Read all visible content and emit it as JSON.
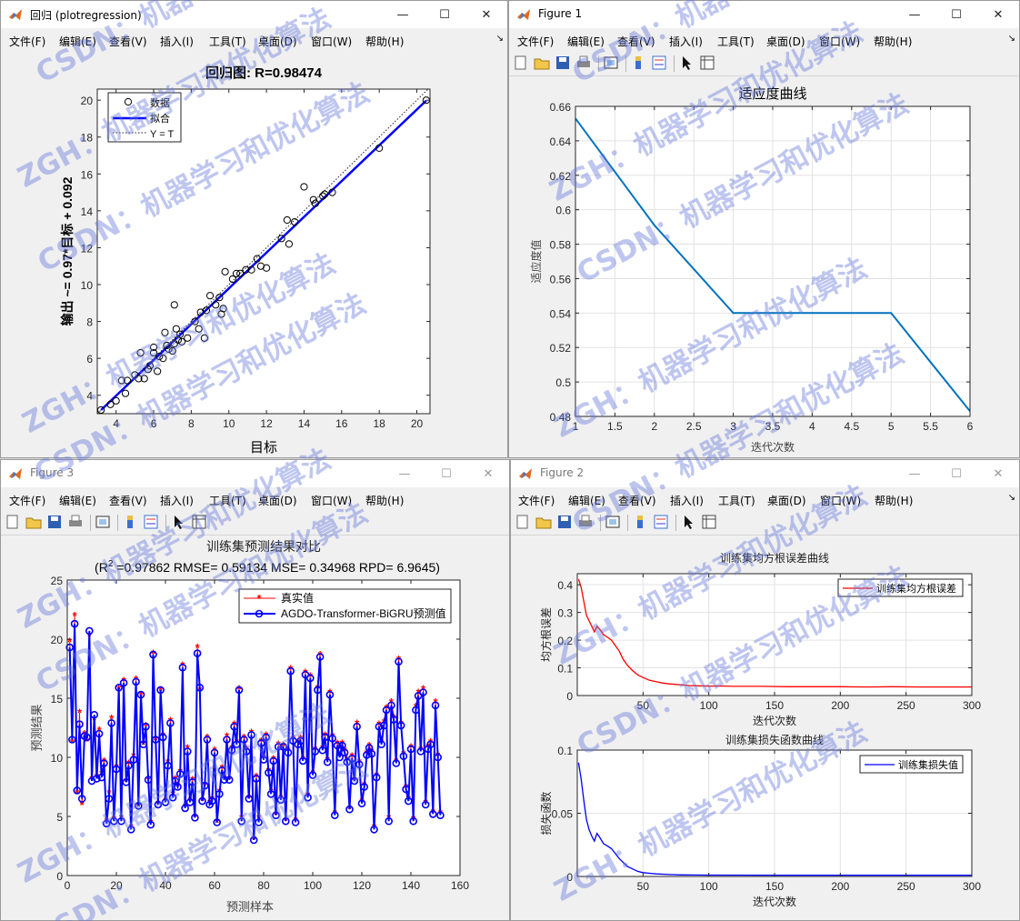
{
  "menu": {
    "file": "文件(F)",
    "edit": "编辑(E)",
    "view": "查看(V)",
    "insert": "插入(I)",
    "tools": "工具(T)",
    "desktop": "桌面(D)",
    "window": "窗口(W)",
    "help": "帮助(H)"
  },
  "windows": {
    "w1": {
      "title": "回归 (plotregression)"
    },
    "w2": {
      "title": "Figure 1"
    },
    "w3": {
      "title": "Figure 3"
    },
    "w4": {
      "title": "Figure 2"
    }
  },
  "watermark": {
    "line1": "CSDN：机器学习和优化算法",
    "line2": "ZGH：机器学习和优化算法"
  },
  "chart_data": [
    {
      "type": "scatter",
      "title": "回归图: R=0.98474",
      "xlabel": "目标",
      "ylabel": "输出 ~= 0.97*目标 + 0.092",
      "xlim": [
        3,
        20.7
      ],
      "ylim": [
        3,
        20.6
      ],
      "xticks": [
        4,
        6,
        8,
        10,
        12,
        14,
        16,
        18,
        20
      ],
      "yticks": [
        4,
        6,
        8,
        10,
        12,
        14,
        16,
        18,
        20
      ],
      "legend": [
        "数据",
        "拟合",
        "Y = T"
      ],
      "legend_position": "top-left",
      "fit": {
        "slope": 0.97,
        "intercept": 0.092
      },
      "points": [
        [
          3.2,
          3.2
        ],
        [
          3.7,
          3.5
        ],
        [
          4.0,
          3.7
        ],
        [
          4.3,
          4.8
        ],
        [
          4.5,
          4.1
        ],
        [
          4.6,
          4.8
        ],
        [
          5.0,
          5.1
        ],
        [
          5.2,
          4.9
        ],
        [
          5.3,
          6.3
        ],
        [
          5.5,
          4.9
        ],
        [
          5.7,
          5.4
        ],
        [
          5.8,
          5.6
        ],
        [
          6.0,
          6.3
        ],
        [
          6.0,
          6.6
        ],
        [
          6.2,
          5.3
        ],
        [
          6.3,
          6.1
        ],
        [
          6.5,
          6.0
        ],
        [
          6.6,
          7.4
        ],
        [
          6.8,
          6.5
        ],
        [
          7.0,
          6.4
        ],
        [
          7.1,
          6.8
        ],
        [
          7.2,
          7.6
        ],
        [
          7.3,
          7.0
        ],
        [
          7.4,
          7.3
        ],
        [
          7.5,
          6.9
        ],
        [
          7.8,
          7.1
        ],
        [
          8.2,
          8.0
        ],
        [
          8.4,
          7.6
        ],
        [
          8.5,
          8.5
        ],
        [
          8.8,
          8.6
        ],
        [
          9.0,
          9.4
        ],
        [
          9.3,
          8.9
        ],
        [
          9.5,
          9.3
        ],
        [
          9.6,
          8.4
        ],
        [
          9.7,
          8.7
        ],
        [
          9.8,
          10.7
        ],
        [
          10.2,
          10.3
        ],
        [
          10.4,
          10.6
        ],
        [
          10.6,
          10.6
        ],
        [
          10.9,
          10.8
        ],
        [
          11.2,
          10.8
        ],
        [
          11.5,
          11.4
        ],
        [
          11.7,
          11.0
        ],
        [
          12.0,
          10.9
        ],
        [
          12.8,
          12.5
        ],
        [
          13.1,
          13.5
        ],
        [
          13.2,
          12.2
        ],
        [
          13.5,
          13.4
        ],
        [
          14.0,
          15.3
        ],
        [
          14.5,
          14.6
        ],
        [
          14.6,
          14.4
        ],
        [
          15.0,
          14.8
        ],
        [
          15.1,
          14.9
        ],
        [
          15.5,
          15.0
        ],
        [
          18.0,
          17.4
        ],
        [
          20.5,
          20.0
        ],
        [
          7.1,
          8.9
        ],
        [
          6.7,
          6.7
        ],
        [
          8.7,
          7.1
        ]
      ]
    },
    {
      "type": "line",
      "title": "适应度曲线",
      "xlabel": "迭代次数",
      "ylabel": "适应度值",
      "xlim": [
        1,
        6
      ],
      "ylim": [
        0.48,
        0.66
      ],
      "xticks": [
        1,
        1.5,
        2,
        2.5,
        3,
        3.5,
        4,
        4.5,
        5,
        5.5,
        6
      ],
      "yticks": [
        0.48,
        0.5,
        0.52,
        0.54,
        0.56,
        0.58,
        0.6,
        0.62,
        0.64,
        0.66
      ],
      "xtick_labels": [
        "1",
        "1.5",
        "2",
        "2.5",
        "3",
        "3.5",
        "4",
        "4.5",
        "5",
        "5.5",
        "6"
      ],
      "ytick_labels": [
        "0.48",
        "0.5",
        "0.52",
        "0.54",
        "0.56",
        "0.58",
        "0.6",
        "0.62",
        "0.64",
        "0.66"
      ],
      "grid": true,
      "x": [
        1,
        2,
        3,
        4,
        5,
        6
      ],
      "y": [
        0.653,
        0.591,
        0.54,
        0.54,
        0.54,
        0.483
      ]
    },
    {
      "type": "line",
      "title": "训练集预测结果对比",
      "subtitle_pre": "(R",
      "subtitle_sup": "2",
      "subtitle_post": " =0.97862 RMSE= 0.59134 MSE= 0.34968 RPD= 6.9645)",
      "xlabel": "预测样本",
      "ylabel": "预测结果",
      "xlim": [
        0,
        160
      ],
      "ylim": [
        0,
        25
      ],
      "xticks": [
        0,
        20,
        40,
        60,
        80,
        100,
        120,
        140,
        160
      ],
      "yticks": [
        0,
        5,
        10,
        15,
        20,
        25
      ],
      "legend_position": "top-right",
      "series": [
        {
          "name": "真实值",
          "color": "#ff0000",
          "marker": "*",
          "values": [
            19.8,
            11.3,
            22.0,
            7.0,
            13.8,
            6.0,
            12.0,
            11.4,
            20.3,
            8.2,
            13.2,
            8.4,
            12.3,
            8.6,
            9.7,
            4.6,
            7.0,
            13.3,
            4.8,
            9.2,
            15.8,
            4.9,
            16.5,
            8.0,
            9.5,
            4.1,
            10.1,
            16.6,
            5.9,
            15.3,
            11.1,
            12.7,
            8.2,
            4.5,
            18.8,
            11.5,
            6.1,
            15.7,
            11.9,
            6.4,
            9.6,
            13.1,
            6.9,
            8.2,
            7.6,
            8.8,
            17.8,
            5.9,
            10.8,
            6.4,
            8.1,
            5.0,
            19.3,
            15.7,
            6.4,
            7.7,
            11.7,
            6.2,
            6.5,
            10.6,
            4.5,
            7.1,
            9.1,
            8.3,
            11.8,
            8.2,
            10.8,
            12.8,
            11.3,
            15.8,
            4.9,
            11.7,
            10.7,
            6.6,
            12.1,
            3.1,
            8.4,
            4.9,
            11.4,
            10.0,
            11.9,
            8.9,
            7.1,
            9.9,
            5.2,
            11.1,
            6.6,
            11.0,
            4.7,
            10.6,
            17.5,
            11.6,
            4.7,
            11.3,
            11.6,
            9.9,
            17.2,
            6.8,
            16.9,
            8.7,
            10.7,
            15.9,
            18.7,
            10.8,
            11.9,
            9.8,
            15.5,
            11.8,
            5.3,
            11.2,
            10.2,
            11.2,
            10.6,
            9.8,
            5.7,
            10.1,
            8.1,
            12.9,
            9.6,
            6.3,
            7.7,
            10.4,
            11.0,
            10.5,
            4.1,
            8.5,
            12.8,
            11.3,
            13.0,
            14.2,
            4.9,
            14.7,
            13.4,
            9.7,
            18.3,
            12.9,
            10.3,
            7.5,
            6.5,
            10.9,
            4.8,
            14.3,
            15.5,
            10.7,
            15.8,
            6.2,
            10.9,
            11.3,
            5.4,
            14.7,
            10.2,
            5.3
          ]
        },
        {
          "name": "AGDO-Transformer-BiGRU预测值",
          "color": "#0000ff",
          "marker": "o",
          "values": [
            19.3,
            11.5,
            21.3,
            7.2,
            12.8,
            6.5,
            11.8,
            11.7,
            20.7,
            8.0,
            13.6,
            8.2,
            12.0,
            8.3,
            9.5,
            4.4,
            6.5,
            12.9,
            4.6,
            9.0,
            15.9,
            4.6,
            16.3,
            7.9,
            9.3,
            3.9,
            9.8,
            16.4,
            5.9,
            15.3,
            11.1,
            12.6,
            8.1,
            4.3,
            18.7,
            11.5,
            6.0,
            15.7,
            11.7,
            6.2,
            9.3,
            12.9,
            6.6,
            8.0,
            7.5,
            8.6,
            17.6,
            5.7,
            10.5,
            6.2,
            7.9,
            4.9,
            18.8,
            15.9,
            6.3,
            7.6,
            11.5,
            6.0,
            6.3,
            10.4,
            4.5,
            6.9,
            8.9,
            8.1,
            11.5,
            8.1,
            10.6,
            12.6,
            11.1,
            15.7,
            4.6,
            11.5,
            10.5,
            6.5,
            11.9,
            3.0,
            8.2,
            4.5,
            11.2,
            9.8,
            11.7,
            8.7,
            6.9,
            9.7,
            5.1,
            10.9,
            6.4,
            10.9,
            4.6,
            10.4,
            17.3,
            11.4,
            4.5,
            11.1,
            11.4,
            9.7,
            17.0,
            6.6,
            16.7,
            8.5,
            10.5,
            15.7,
            18.5,
            10.6,
            11.7,
            9.6,
            15.3,
            11.6,
            5.1,
            11.0,
            10.0,
            11.0,
            10.4,
            9.6,
            5.6,
            9.9,
            8.0,
            12.6,
            9.4,
            6.1,
            7.5,
            10.2,
            10.8,
            10.3,
            3.9,
            8.3,
            12.6,
            11.1,
            12.7,
            14.0,
            4.6,
            14.4,
            13.2,
            9.5,
            18.1,
            12.7,
            10.1,
            7.3,
            6.3,
            10.7,
            4.6,
            14.0,
            15.2,
            10.5,
            15.5,
            6.0,
            10.7,
            11.1,
            5.2,
            14.4,
            10.0,
            5.1
          ]
        }
      ]
    },
    {
      "type": "line",
      "title": "训练集均方根误差曲线",
      "xlabel": "迭代次数",
      "ylabel": "均方根误差",
      "xlim": [
        0,
        300
      ],
      "ylim": [
        0,
        0.44
      ],
      "xticks": [
        50,
        100,
        150,
        200,
        250,
        300
      ],
      "yticks": [
        0,
        0.1,
        0.2,
        0.3,
        0.4
      ],
      "xtick_labels": [
        "50",
        "100",
        "150",
        "200",
        "250",
        "300"
      ],
      "ytick_labels": [
        "0",
        "0.1",
        "0.2",
        "0.3",
        "0.4"
      ],
      "grid": true,
      "series": [
        {
          "name": "训练集均方根误差",
          "color": "#ff0000",
          "x": [
            1,
            3,
            5,
            7,
            9,
            11,
            13,
            15,
            17,
            20,
            23,
            26,
            29,
            32,
            35,
            38,
            42,
            46,
            50,
            55,
            60,
            65,
            70,
            75,
            80,
            85,
            90,
            100,
            110,
            120,
            140,
            160,
            180,
            200,
            220,
            240,
            260,
            280,
            300
          ],
          "y": [
            0.42,
            0.39,
            0.34,
            0.29,
            0.27,
            0.25,
            0.23,
            0.25,
            0.24,
            0.22,
            0.21,
            0.2,
            0.18,
            0.16,
            0.13,
            0.11,
            0.09,
            0.075,
            0.065,
            0.055,
            0.05,
            0.045,
            0.042,
            0.04,
            0.038,
            0.036,
            0.035,
            0.034,
            0.034,
            0.033,
            0.033,
            0.032,
            0.032,
            0.032,
            0.031,
            0.032,
            0.031,
            0.031,
            0.031
          ]
        }
      ]
    },
    {
      "type": "line",
      "title": "训练集损失函数曲线",
      "xlabel": "迭代次数",
      "ylabel": "损失函数",
      "xlim": [
        0,
        300
      ],
      "ylim": [
        0,
        0.1
      ],
      "xticks": [
        50,
        100,
        150,
        200,
        250,
        300
      ],
      "yticks": [
        0,
        0.05,
        0.1
      ],
      "xtick_labels": [
        "50",
        "100",
        "150",
        "200",
        "250",
        "300"
      ],
      "ytick_labels": [
        "0",
        "0.05",
        "0.1"
      ],
      "grid": true,
      "series": [
        {
          "name": "训练集损失值",
          "color": "#0000ff",
          "x": [
            1,
            3,
            5,
            7,
            9,
            11,
            13,
            15,
            17,
            20,
            23,
            26,
            29,
            32,
            35,
            38,
            42,
            46,
            50,
            55,
            60,
            70,
            80,
            100,
            150,
            200,
            250,
            300
          ],
          "y": [
            0.09,
            0.077,
            0.06,
            0.045,
            0.037,
            0.032,
            0.028,
            0.034,
            0.031,
            0.026,
            0.024,
            0.022,
            0.018,
            0.014,
            0.011,
            0.008,
            0.006,
            0.004,
            0.003,
            0.0025,
            0.002,
            0.0015,
            0.0012,
            0.0011,
            0.001,
            0.001,
            0.001,
            0.001
          ]
        }
      ]
    }
  ]
}
